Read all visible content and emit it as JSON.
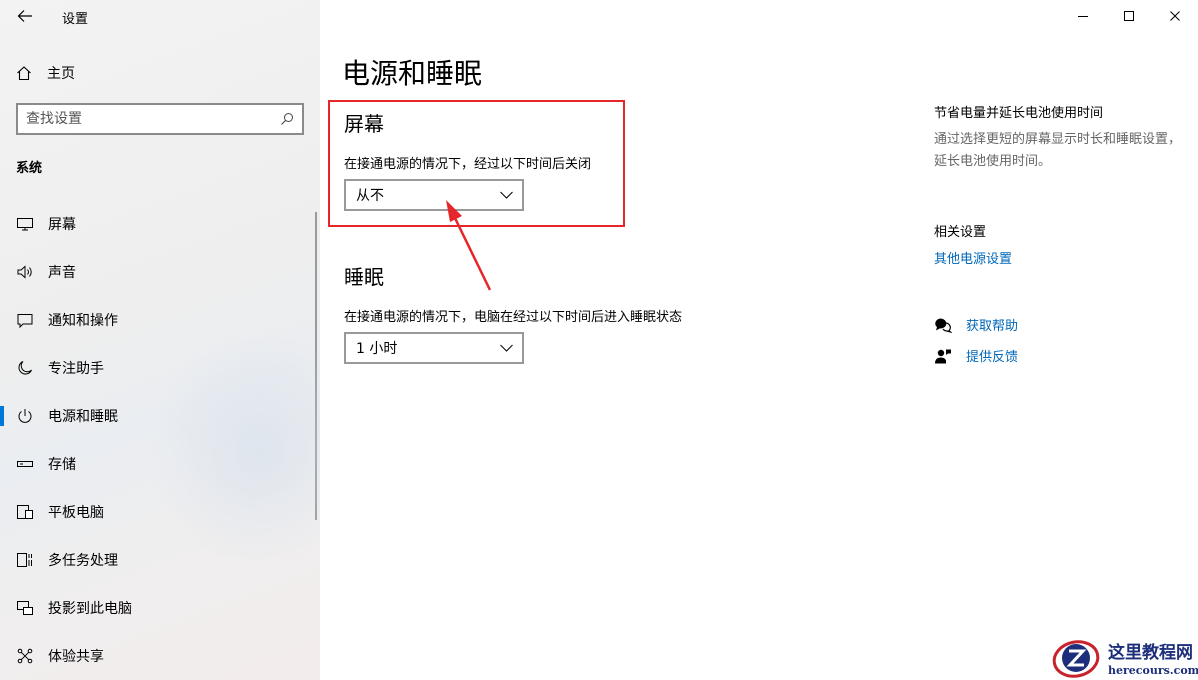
{
  "app": {
    "title": "设置"
  },
  "sidebar": {
    "home_label": "主页",
    "search_placeholder": "查找设置",
    "section": "系统",
    "items": [
      {
        "label": "屏幕",
        "icon": "monitor-icon",
        "active": false
      },
      {
        "label": "声音",
        "icon": "speaker-icon",
        "active": false
      },
      {
        "label": "通知和操作",
        "icon": "notification-icon",
        "active": false
      },
      {
        "label": "专注助手",
        "icon": "moon-icon",
        "active": false
      },
      {
        "label": "电源和睡眠",
        "icon": "power-icon",
        "active": true
      },
      {
        "label": "存储",
        "icon": "storage-icon",
        "active": false
      },
      {
        "label": "平板电脑",
        "icon": "tablet-icon",
        "active": false
      },
      {
        "label": "多任务处理",
        "icon": "multitask-icon",
        "active": false
      },
      {
        "label": "投影到此电脑",
        "icon": "project-icon",
        "active": false
      },
      {
        "label": "体验共享",
        "icon": "share-icon",
        "active": false
      }
    ]
  },
  "main": {
    "title": "电源和睡眠",
    "screen": {
      "title": "屏幕",
      "desc": "在接通电源的情况下，经过以下时间后关闭",
      "value": "从不"
    },
    "sleep": {
      "title": "睡眠",
      "desc": "在接通电源的情况下，电脑在经过以下时间后进入睡眠状态",
      "value": "1 小时"
    }
  },
  "right": {
    "battery_title": "节省电量并延长电池使用时间",
    "battery_desc": "通过选择更短的屏幕显示时长和睡眠设置，延长电池使用时间。",
    "related_title": "相关设置",
    "related_link": "其他电源设置",
    "help_label": "获取帮助",
    "feedback_label": "提供反馈"
  },
  "watermark": {
    "name": "这里教程网",
    "url": "herecours.com"
  },
  "colors": {
    "accent": "#0078d7",
    "link": "#0067b8",
    "highlight": "#e5262b"
  }
}
